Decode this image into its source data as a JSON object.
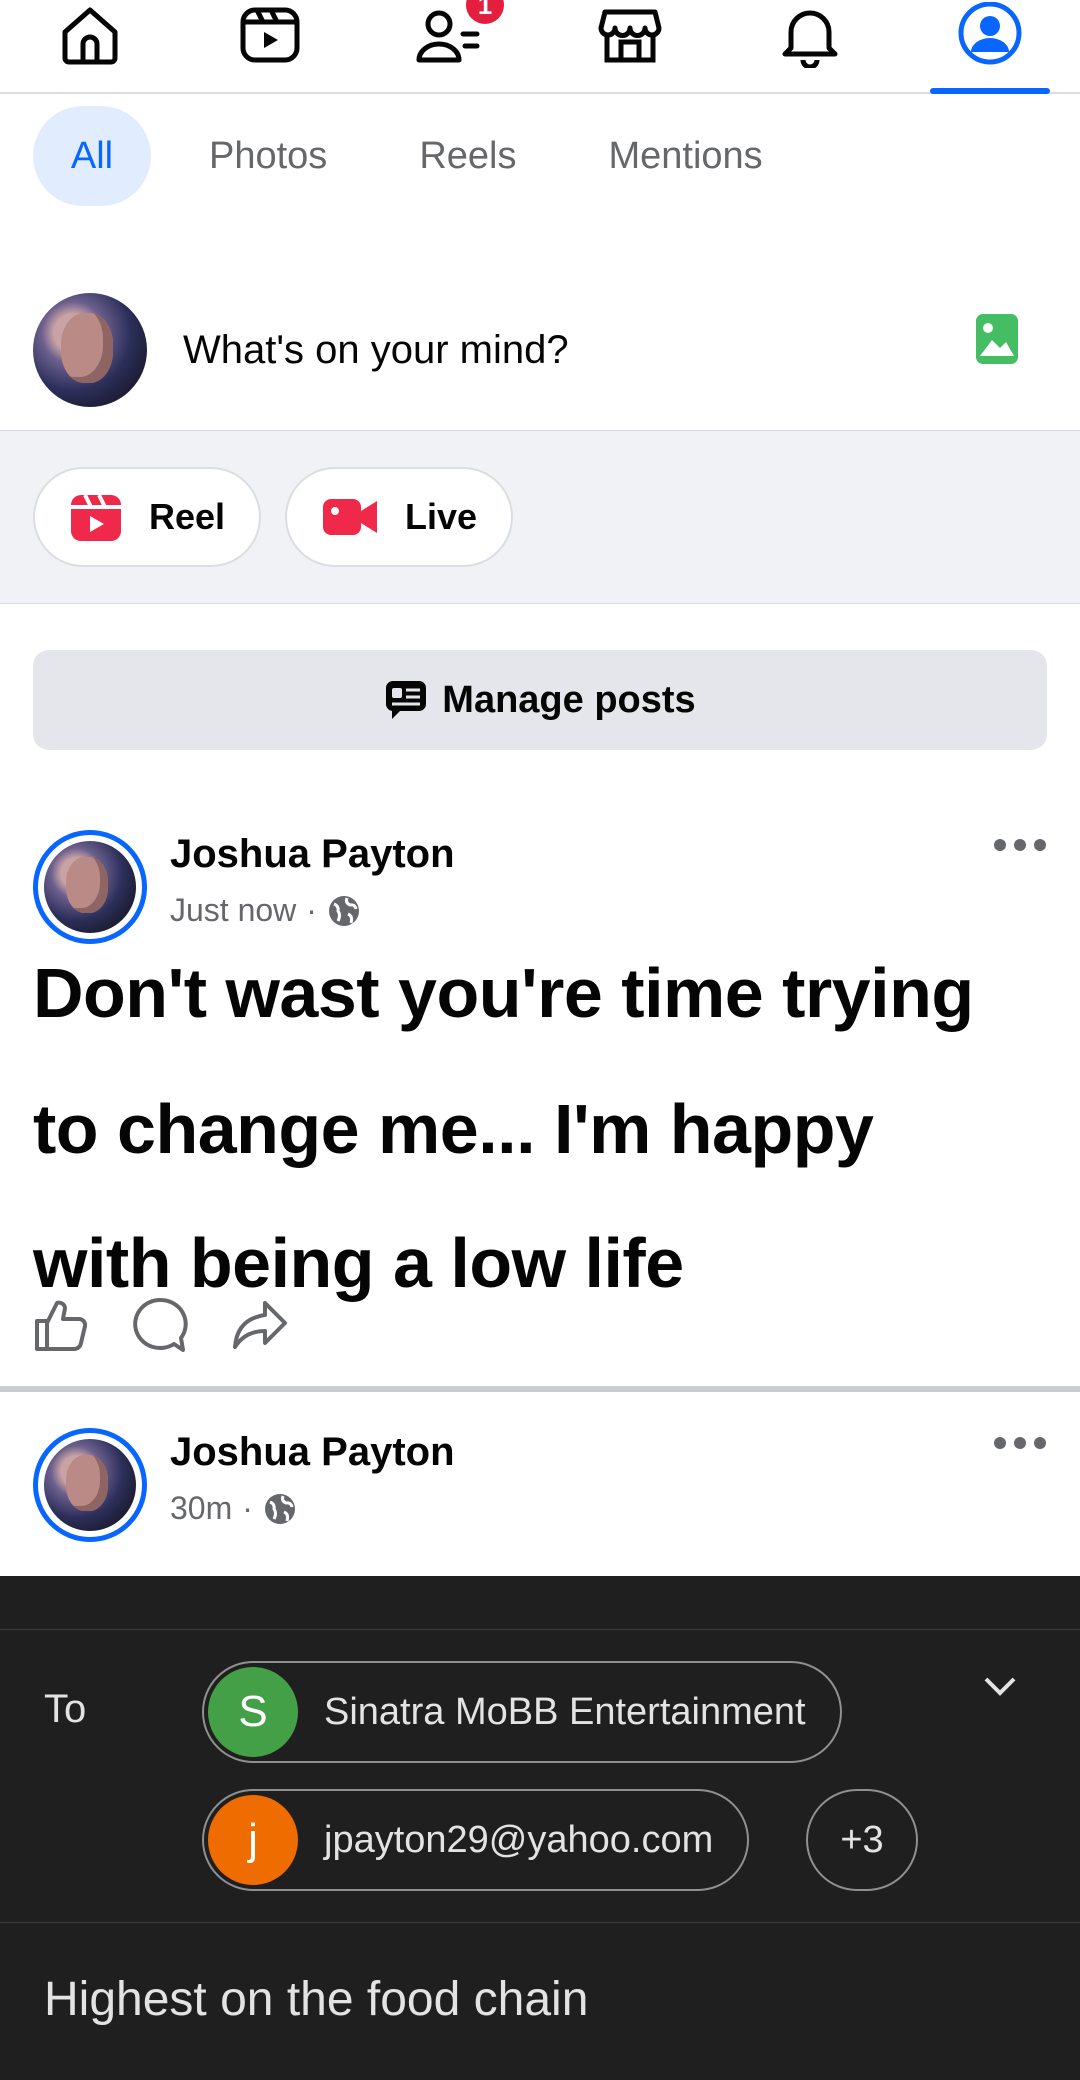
{
  "topnav": {
    "items": [
      {
        "icon": "home-icon"
      },
      {
        "icon": "video-icon"
      },
      {
        "icon": "friends-icon",
        "badge": "1"
      },
      {
        "icon": "marketplace-icon"
      },
      {
        "icon": "bell-icon"
      },
      {
        "icon": "profile-icon",
        "active": true
      }
    ],
    "accent": "#0866ff",
    "badge_color": "#e41e3f"
  },
  "tabs": [
    "All",
    "Photos",
    "Reels",
    "Mentions"
  ],
  "composer": {
    "placeholder": "What's on your mind?"
  },
  "quick_actions": {
    "reel": "Reel",
    "live": "Live"
  },
  "manage_posts": "Manage posts",
  "posts": [
    {
      "author": "Joshua Payton",
      "time": "Just now",
      "text_lines": [
        "Don't wast you're time trying",
        "to change me... I'm happy",
        "with being a low life"
      ]
    },
    {
      "author": "Joshua Payton",
      "time": "30m"
    }
  ],
  "share_sheet": {
    "to_label": "To",
    "recipients": [
      {
        "initial": "S",
        "name": "Sinatra MoBB Entertainment",
        "color": "#43a047"
      },
      {
        "initial": "j",
        "name": "jpayton29@yahoo.com",
        "color": "#ef6c00"
      }
    ],
    "more": "+3",
    "subject": "Highest on the food chain"
  }
}
